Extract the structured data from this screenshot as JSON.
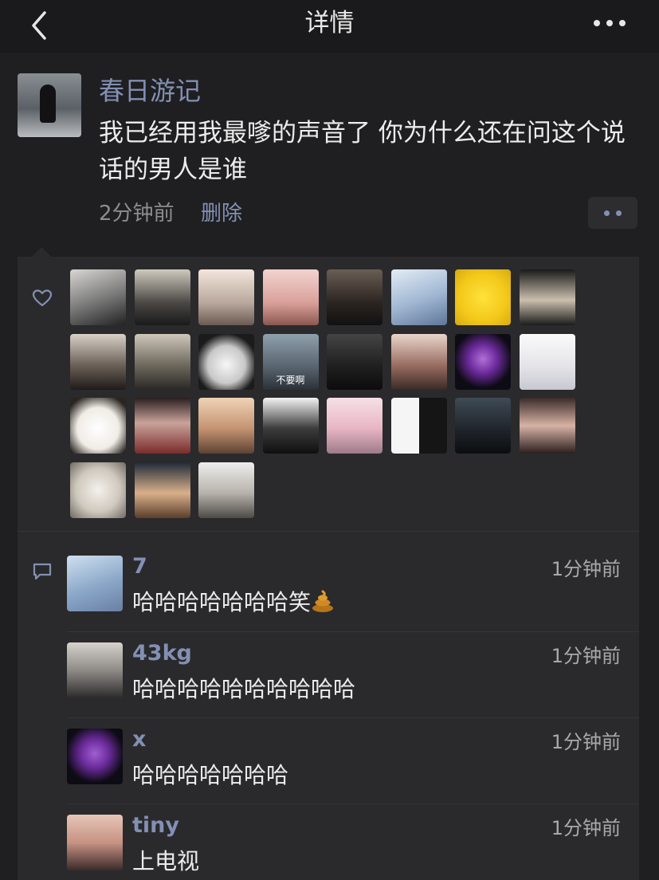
{
  "navbar": {
    "title": "详情",
    "back_icon": "chevron-left-icon",
    "more_icon": "more-horizontal-icon"
  },
  "post": {
    "author": "春日游记",
    "text": "我已经用我最嗲的声音了 你为什么还在问这个说话的男人是谁",
    "time": "2分钟前",
    "delete_label": "删除"
  },
  "likes": {
    "icon": "heart-icon",
    "overlay_caption": "不要啊",
    "count": 27
  },
  "comments": {
    "icon": "comment-icon",
    "items": [
      {
        "name": "7",
        "time": "1分钟前",
        "text": "哈哈哈哈哈哈哈笑"
      },
      {
        "name": "43kg",
        "time": "1分钟前",
        "text": "哈哈哈哈哈哈哈哈哈哈"
      },
      {
        "name": "x",
        "time": "1分钟前",
        "text": "哈哈哈哈哈哈哈"
      },
      {
        "name": "tiny",
        "time": "1分钟前",
        "text": "上电视"
      }
    ]
  },
  "colors": {
    "background": "#1f1f21",
    "panel": "#2a2a2c",
    "link": "#8390b3",
    "secondary_text": "#8d8d8f"
  }
}
